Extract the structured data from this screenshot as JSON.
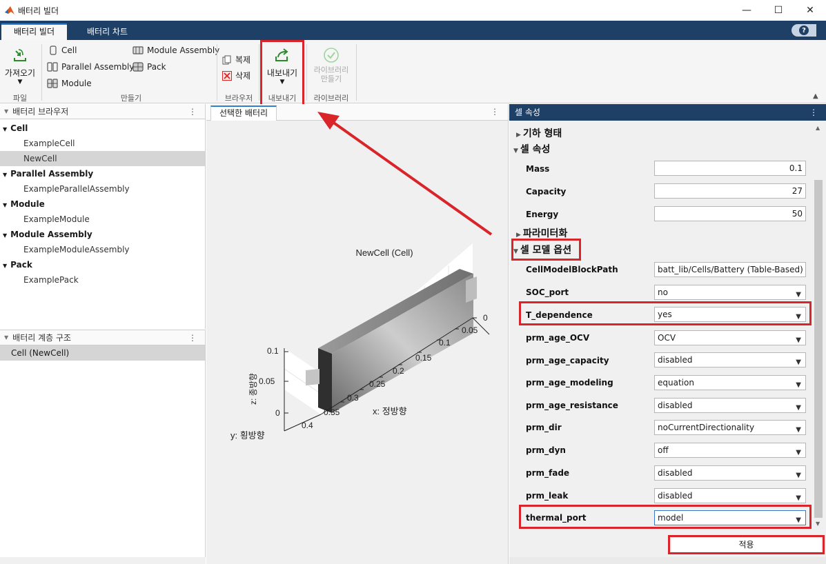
{
  "window": {
    "title": "배터리 빌더",
    "controls": [
      "minimize-icon",
      "maximize-icon",
      "close-icon"
    ]
  },
  "tabs": [
    {
      "label": "배터리 빌더",
      "active": true
    },
    {
      "label": "배터리 차트",
      "active": false
    }
  ],
  "help": {
    "label": "?"
  },
  "toolstrip": {
    "import": {
      "label": "가져오기",
      "section": "파일"
    },
    "create": {
      "section": "만들기",
      "items": [
        "Cell",
        "Parallel Assembly",
        "Module",
        "Module Assembly",
        "Pack"
      ]
    },
    "browser": {
      "section": "브라우저",
      "copy": "복제",
      "delete": "삭제"
    },
    "export": {
      "label": "내보내기",
      "section": "내보내기"
    },
    "library": {
      "label_line1": "라이브러리",
      "label_line2": "만들기",
      "section": "라이브러리"
    }
  },
  "browser": {
    "title": "배터리 브라우저",
    "groups": [
      {
        "name": "Cell",
        "items": [
          "ExampleCell",
          "NewCell"
        ]
      },
      {
        "name": "Parallel Assembly",
        "items": [
          "ExampleParallelAssembly"
        ]
      },
      {
        "name": "Module",
        "items": [
          "ExampleModule"
        ]
      },
      {
        "name": "Module Assembly",
        "items": [
          "ExampleModuleAssembly"
        ]
      },
      {
        "name": "Pack",
        "items": [
          "ExamplePack"
        ]
      }
    ],
    "selected": "NewCell"
  },
  "hierarchy": {
    "title": "배터리 계층 구조",
    "items": [
      "Cell (NewCell)"
    ]
  },
  "viewer": {
    "tab": "선택한 배터리",
    "plot_title": "NewCell (Cell)",
    "x_label": "x: 정방향",
    "y_label": "y: 횡방향",
    "z_label": "z: 종방향",
    "x_ticks": [
      "0",
      "0.05",
      "0.1",
      "0.15",
      "0.2",
      "0.25",
      "0.3",
      "0.35"
    ],
    "y_ticks": [
      "0",
      "0.4"
    ],
    "z_ticks": [
      "0",
      "0.05",
      "0.1"
    ]
  },
  "properties": {
    "title": "셀 속성",
    "sections": {
      "geometry": "기하 형태",
      "cell_props": "셀 속성",
      "param": "파라미터화",
      "model_opts": "셀 모델 옵션"
    },
    "cell_fields": [
      {
        "label": "Mass",
        "value": "0.1"
      },
      {
        "label": "Capacity",
        "value": "27"
      },
      {
        "label": "Energy",
        "value": "50"
      }
    ],
    "model_fields": [
      {
        "label": "CellModelBlockPath",
        "value": "batt_lib/Cells/Battery (Table-Based)",
        "type": "text"
      },
      {
        "label": "SOC_port",
        "value": "no",
        "type": "select"
      },
      {
        "label": "T_dependence",
        "value": "yes",
        "type": "select"
      },
      {
        "label": "prm_age_OCV",
        "value": "OCV",
        "type": "select"
      },
      {
        "label": "prm_age_capacity",
        "value": "disabled",
        "type": "select"
      },
      {
        "label": "prm_age_modeling",
        "value": "equation",
        "type": "select"
      },
      {
        "label": "prm_age_resistance",
        "value": "disabled",
        "type": "select"
      },
      {
        "label": "prm_dir",
        "value": "noCurrentDirectionality",
        "type": "select"
      },
      {
        "label": "prm_dyn",
        "value": "off",
        "type": "select"
      },
      {
        "label": "prm_fade",
        "value": "disabled",
        "type": "select"
      },
      {
        "label": "prm_leak",
        "value": "disabled",
        "type": "select"
      },
      {
        "label": "thermal_port",
        "value": "model",
        "type": "select"
      }
    ],
    "apply": "적용"
  },
  "colors": {
    "header_blue": "#1e3f66",
    "highlight_red": "#d9252a"
  }
}
